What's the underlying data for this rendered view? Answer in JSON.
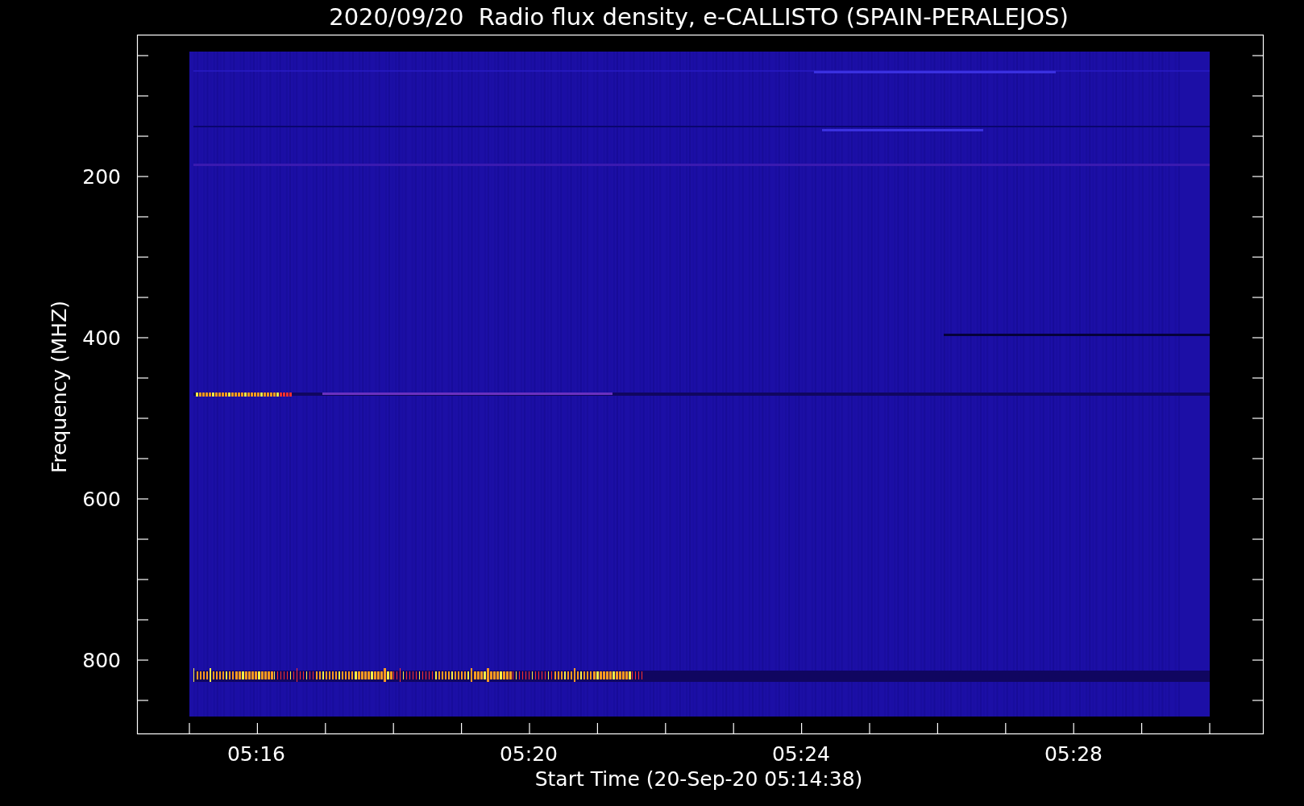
{
  "title": "2020/09/20  Radio flux density, e-CALLISTO (SPAIN-PERALEJOS)",
  "y_axis": {
    "label": "Frequency (MHZ)",
    "ticks": [
      "200",
      "400",
      "600",
      "800"
    ]
  },
  "x_axis": {
    "label": "Start Time (20-Sep-20 05:14:38)",
    "ticks": [
      "05:16",
      "05:20",
      "05:24",
      "05:28"
    ]
  }
}
